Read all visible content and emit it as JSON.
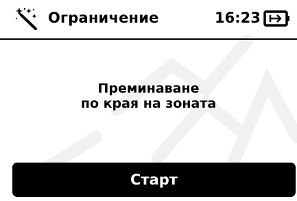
{
  "header": {
    "mode_icon": "magic-wand-icon",
    "title": "Ограничение",
    "time": "16:23",
    "battery_icon": "battery-icon"
  },
  "main": {
    "message_line1": "Преминаване",
    "message_line2": "по края на зоната"
  },
  "footer": {
    "start_label": "Старт"
  }
}
